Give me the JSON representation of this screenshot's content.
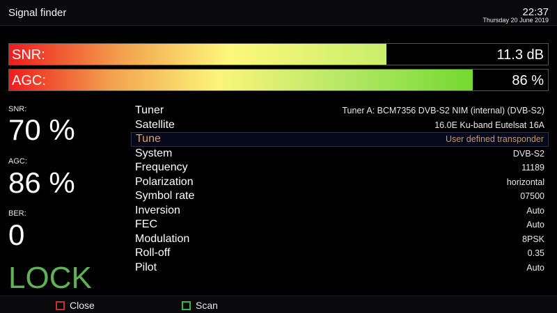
{
  "header": {
    "title": "Signal finder",
    "time": "22:37",
    "date": "Thursday 20 June 2019"
  },
  "bars": {
    "snr": {
      "label": "SNR:",
      "value": "11.3 dB",
      "level": 0.7
    },
    "agc": {
      "label": "AGC:",
      "value": "86 %",
      "level": 0.86
    }
  },
  "stats": {
    "snr_label": "SNR:",
    "snr_value": "70 %",
    "agc_label": "AGC:",
    "agc_value": "86 %",
    "ber_label": "BER:",
    "ber_value": "0",
    "lock": "LOCK"
  },
  "colors": {
    "lock": "#5fb255",
    "highlight": "#e0a64a",
    "close_key": "#d22b2b",
    "scan_key": "#3bb54a"
  },
  "rows": [
    {
      "key": "Tuner",
      "value": "Tuner A: BCM7356 DVB-S2 NIM (internal) (DVB-S2)"
    },
    {
      "key": "Satellite",
      "value": "16.0E Ku-band Eutelsat 16A"
    },
    {
      "key": "Tune",
      "value": "User defined transponder",
      "selected": true
    },
    {
      "key": "System",
      "value": "DVB-S2"
    },
    {
      "key": "Frequency",
      "value": "11189"
    },
    {
      "key": "Polarization",
      "value": "horizontal"
    },
    {
      "key": "Symbol rate",
      "value": "07500"
    },
    {
      "key": "Inversion",
      "value": "Auto"
    },
    {
      "key": "FEC",
      "value": "Auto"
    },
    {
      "key": "Modulation",
      "value": "8PSK"
    },
    {
      "key": "Roll-off",
      "value": "0.35"
    },
    {
      "key": "Pilot",
      "value": "Auto"
    }
  ],
  "footer": {
    "close": "Close",
    "scan": "Scan"
  }
}
